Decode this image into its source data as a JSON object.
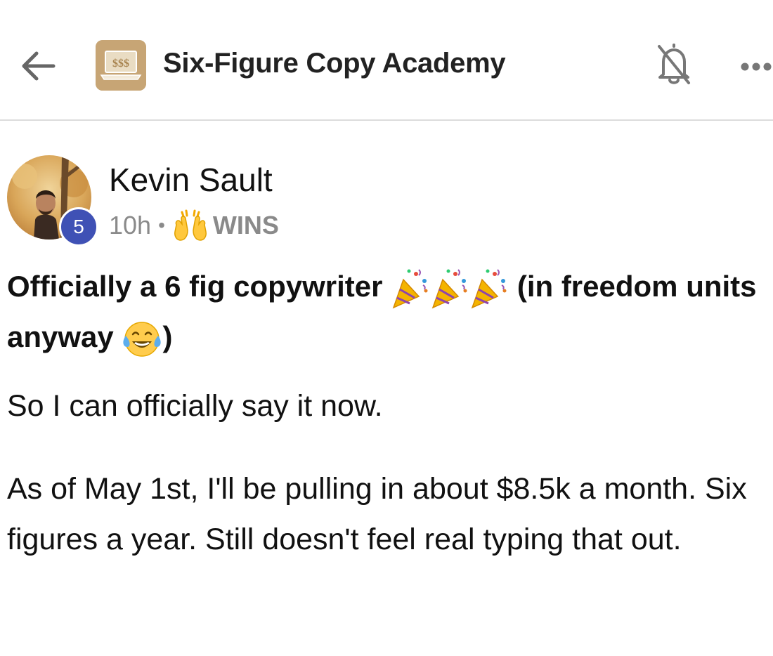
{
  "header": {
    "back_icon": "arrow-left-icon",
    "group_logo_icon": "laptop-dollar-icon",
    "group_logo_text": "$$$",
    "title": "Six-Figure Copy Academy",
    "bell_icon": "bell-muted-icon",
    "more_icon": "more-horizontal-icon"
  },
  "post": {
    "author": {
      "name": "Kevin Sault",
      "level": "5",
      "avatar_icon": "user-avatar"
    },
    "meta": {
      "time": "10h",
      "separator": "•",
      "category_emoji": "raising-hands-emoji",
      "category": "WINS"
    },
    "title_part1": "Officially a 6 fig copywriter",
    "title_part2": "(in freedom units anyway",
    "title_part3": ")",
    "title_emojis": [
      "party-popper-emoji",
      "party-popper-emoji",
      "party-popper-emoji",
      "tears-of-joy-emoji"
    ],
    "paragraphs": [
      "So I can officially say it now.",
      "As of May 1st, I'll be pulling in about $8.5k a month. Six figures a year. Still doesn't feel real typing that out."
    ]
  },
  "colors": {
    "badge": "#3f51b5",
    "logo_bg": "#c9a97a",
    "muted_text": "#8a8a8a"
  }
}
